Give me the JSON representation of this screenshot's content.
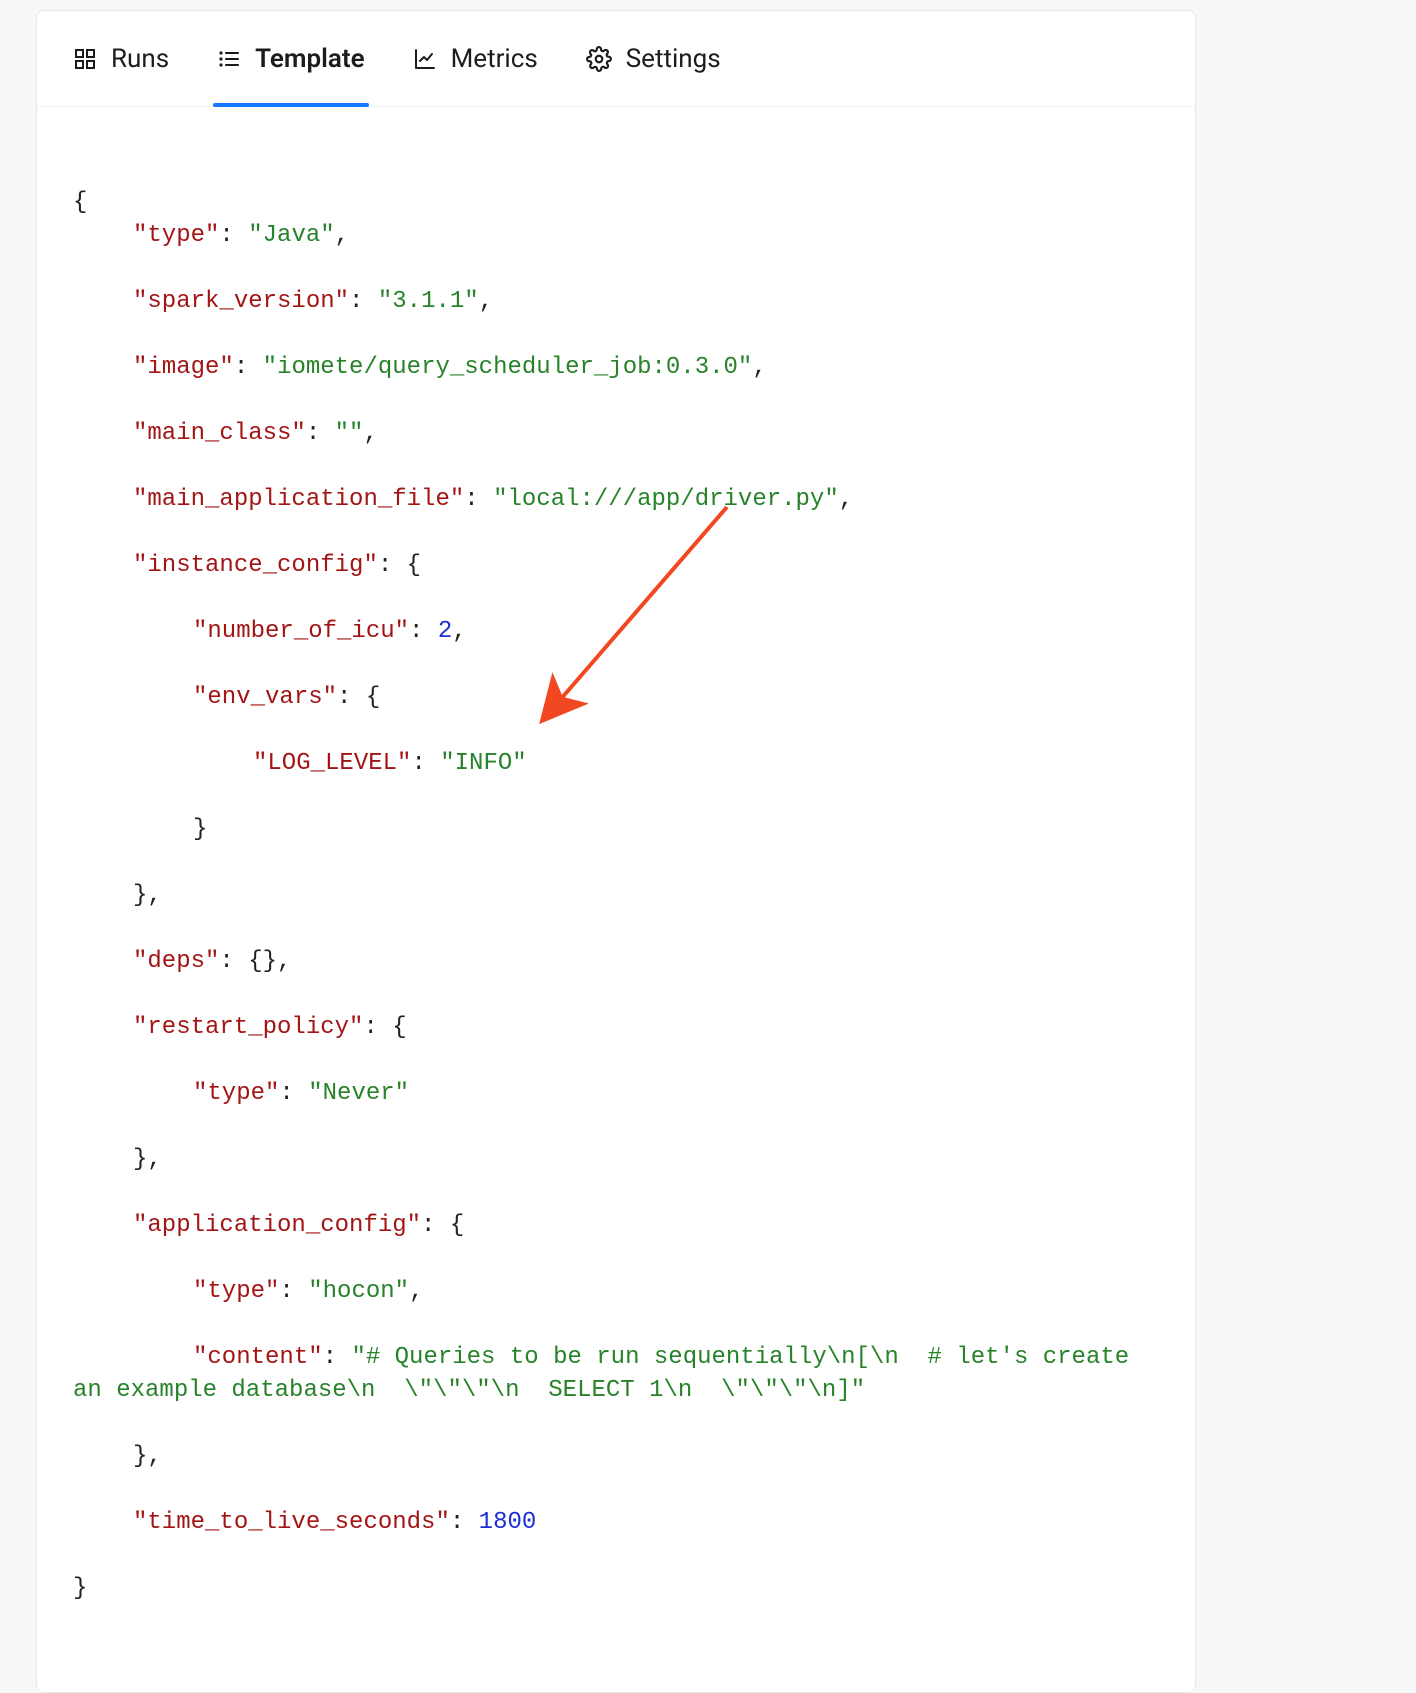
{
  "tabs": {
    "runs": "Runs",
    "template": "Template",
    "metrics": "Metrics",
    "settings": "Settings"
  },
  "code": {
    "open": "{",
    "close": "}",
    "k_type": "\"type\"",
    "v_type": "\"Java\"",
    "k_spark_version": "\"spark_version\"",
    "v_spark_version": "\"3.1.1\"",
    "k_image": "\"image\"",
    "v_image": "\"iomete/query_scheduler_job:0.3.0\"",
    "k_main_class": "\"main_class\"",
    "v_main_class": "\"\"",
    "k_main_app_file": "\"main_application_file\"",
    "v_main_app_file": "\"local:///app/driver.py\"",
    "k_instance_config": "\"instance_config\"",
    "k_number_of_icu": "\"number_of_icu\"",
    "v_number_of_icu": "2",
    "k_env_vars": "\"env_vars\"",
    "k_log_level": "\"LOG_LEVEL\"",
    "v_log_level": "\"INFO\"",
    "k_deps": "\"deps\"",
    "k_restart_policy": "\"restart_policy\"",
    "k_rp_type": "\"type\"",
    "v_rp_type": "\"Never\"",
    "k_application_config": "\"application_config\"",
    "k_ac_type": "\"type\"",
    "v_ac_type": "\"hocon\"",
    "k_ac_content": "\"content\"",
    "v_ac_content": "\"# Queries to be run sequentially\\n[\\n  # let's create an example database\\n  \\\"\\\"\\\"\\n  SELECT 1\\n  \\\"\\\"\\\"\\n]\"",
    "k_ttl": "\"time_to_live_seconds\"",
    "v_ttl": "1800",
    "colon": ": ",
    "comma": ",",
    "brace_open": "{",
    "brace_close": "}",
    "empty_obj": "{}"
  },
  "arrow_color": "#f24822"
}
